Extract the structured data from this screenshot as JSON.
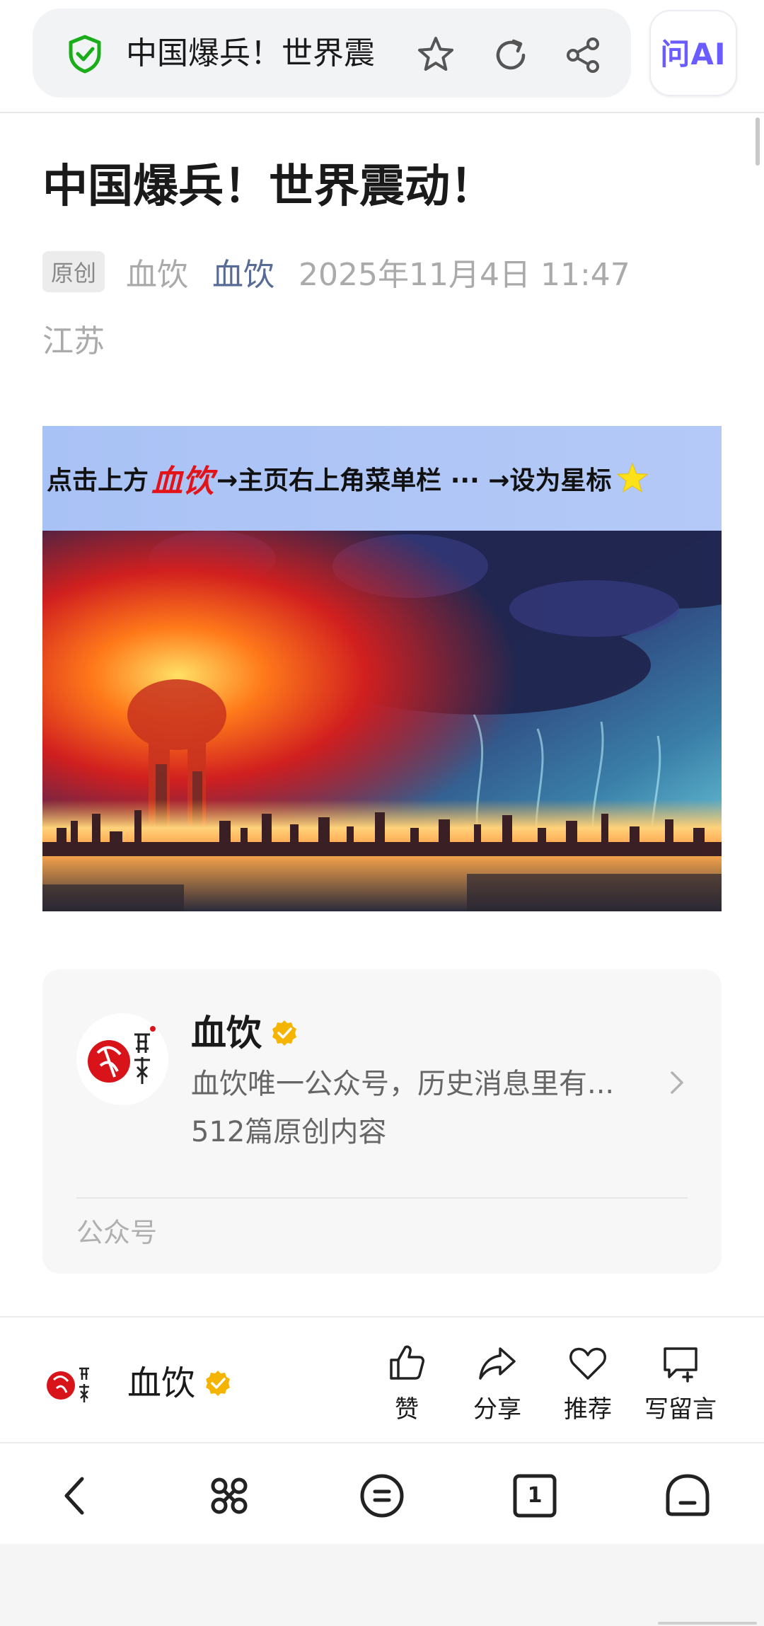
{
  "browser": {
    "tab_title": "中国爆兵！世界震",
    "ai_label": "问AI"
  },
  "article": {
    "title": "中国爆兵！世界震动！",
    "tag": "原创",
    "author": "血饮",
    "account": "血饮",
    "date": "2025年11月4日 11:47",
    "location": "江苏"
  },
  "banner": {
    "prefix": "点击上方",
    "brand": "血饮",
    "suffix": "→主页右上角菜单栏 ··· →设为星标"
  },
  "card": {
    "name": "血饮",
    "description": "血饮唯一公众号，历史消息里有...",
    "count": "512篇原创内容",
    "footer": "公众号"
  },
  "actionbar": {
    "name": "血饮",
    "like": "赞",
    "share": "分享",
    "recommend": "推荐",
    "comment": "写留言"
  },
  "nav": {
    "tabs_count": "1"
  },
  "colors": {
    "link_blue": "#576b95",
    "verify_gold": "#f5b400",
    "shield_green": "#1aad19"
  }
}
